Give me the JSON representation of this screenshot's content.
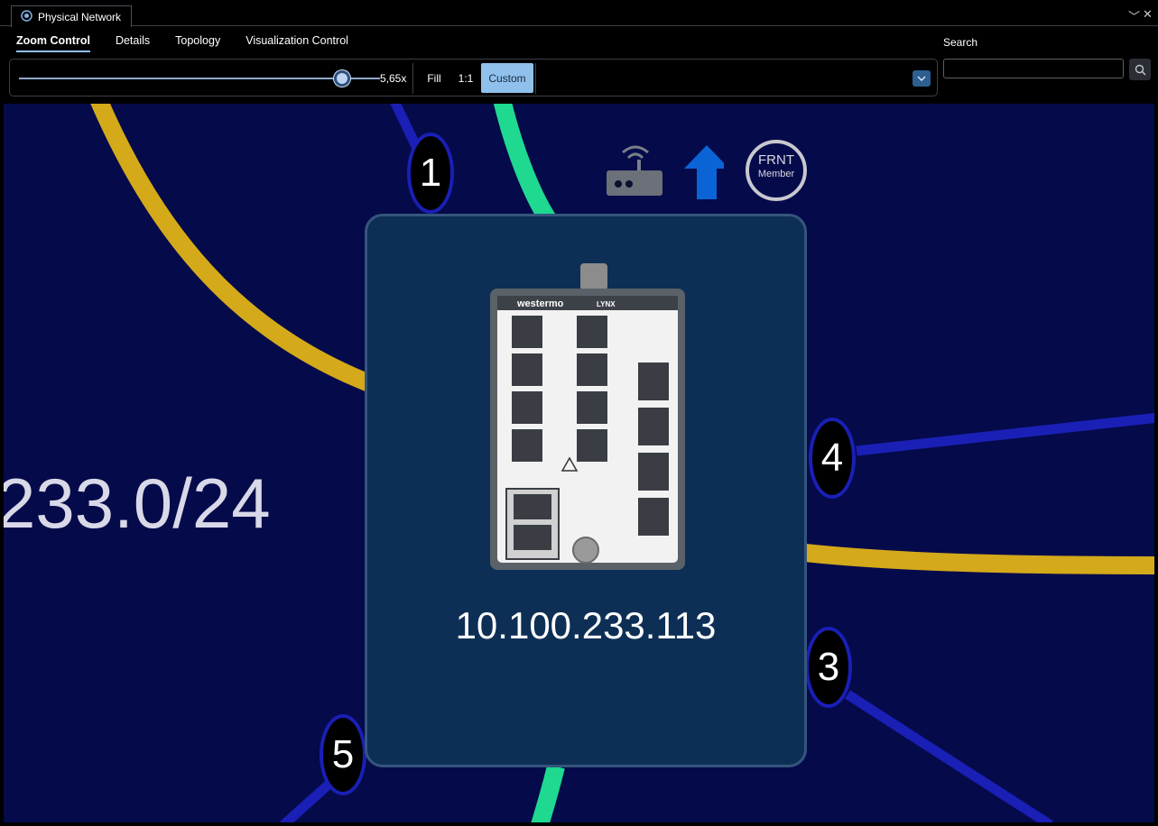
{
  "window": {
    "tab_title": "Physical Network",
    "minimize_glyph": "﹀",
    "close_glyph": "✕"
  },
  "tabs": [
    {
      "label": "Zoom Control",
      "active": true
    },
    {
      "label": "Details",
      "active": false
    },
    {
      "label": "Topology",
      "active": false
    },
    {
      "label": "Visualization Control",
      "active": false
    }
  ],
  "zoom": {
    "value_label": "5,65x",
    "slider_level": 0.89,
    "fill_label": "Fill",
    "one_to_one_label": "1:1",
    "custom_label": "Custom"
  },
  "search": {
    "label": "Search",
    "value": "",
    "placeholder": ""
  },
  "topology": {
    "subnet_label": "233.0/24",
    "node_ip": "10.100.233.113",
    "ports": [
      "1",
      "4",
      "3",
      "5"
    ],
    "frnt_badge": {
      "line1": "FRNT",
      "line2": "Member"
    },
    "device_brand": "westermo",
    "device_model": "LYNX",
    "link_colors": {
      "yellow": "#d4a91a",
      "green": "#1ed98f",
      "blue": "#1a1fb5"
    }
  },
  "colors": {
    "canvas_bg": "#050a4a",
    "node_bg": "#0e2f55",
    "accent": "#8fc1ec"
  }
}
